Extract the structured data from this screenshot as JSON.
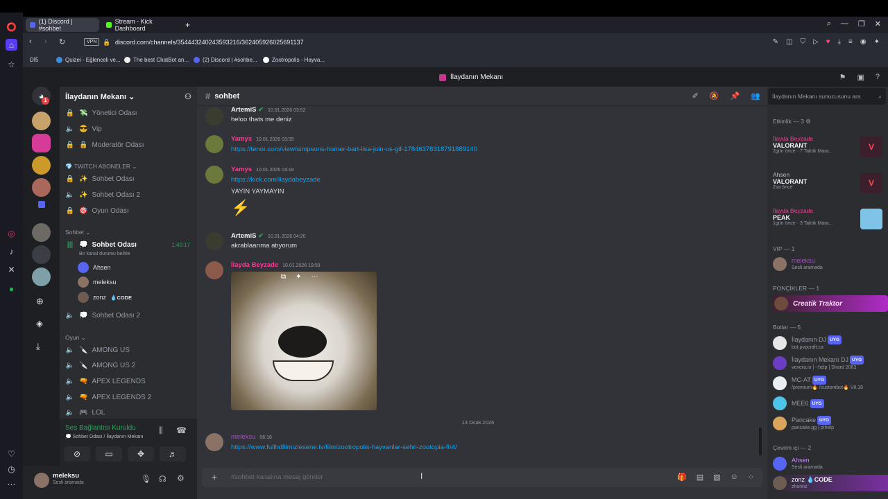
{
  "browser": {
    "tabs": [
      {
        "label": "(1) Discord | #sohbet"
      },
      {
        "label": "Stream - Kick Dashboard"
      }
    ],
    "vpn_label": "VPN",
    "url": "discord.com/channels/354443240243593216/362405926025691137",
    "bookmarks": [
      "Dİ5",
      "Quizei - Eğlenceli ve...",
      "The best ChatBot an...",
      "(2) Discord | #sohbe...",
      "Zootropolis - Hayva..."
    ]
  },
  "window_title": "İlaydanın Mekanı",
  "server": {
    "name": "İlaydanın Mekanı",
    "channels_top": [
      {
        "label": "Yönetici Odası",
        "emoji": "💸"
      },
      {
        "label": "Vip",
        "emoji": "😎"
      },
      {
        "label": "Moderatör Odası",
        "emoji": "🔒"
      }
    ],
    "cat_twitch": "TWITCH ABONELER",
    "channels_twitch": [
      {
        "label": "Sohbet Odası",
        "emoji": "✨"
      },
      {
        "label": "Sohbet Odası 2",
        "emoji": "✨"
      },
      {
        "label": "Oyun Odası",
        "emoji": "🎯"
      }
    ],
    "cat_sohbet": "Sohbet",
    "active_channel": {
      "label": "Sohbet Odası",
      "timer": "1:40:17",
      "status": "Bir kanal durumu belirle"
    },
    "voice_users": [
      {
        "name": "Ahsen"
      },
      {
        "name": "meleksu"
      },
      {
        "name": "zonz",
        "tag": "CODE"
      }
    ],
    "channel_sohbet2": "Sohbet Odası 2",
    "cat_oyun": "Oyun",
    "channels_oyun": [
      "AMONG US",
      "AMONG US 2",
      "APEX LEGENDS",
      "APEX LEGENDS 2",
      "LOL"
    ]
  },
  "voice_panel": {
    "status": "Ses Bağlantısı Kuruldu",
    "location": "Sohbet Odası / İlaydanın Mekanı"
  },
  "user": {
    "name": "meleksu",
    "status": "Sesli aramada"
  },
  "chat": {
    "channel": "sohbet",
    "messages": [
      {
        "author": "ArtemiS",
        "time": "10.01.2026 03:52",
        "text": "heloo thats me deniz"
      },
      {
        "author": "Yamys",
        "time": "10.01.2026 03:55",
        "text": "https://tenor.com/view/simpsons-homer-bart-lisa-join-us-gif-17846376318791889140"
      },
      {
        "author": "Yamys",
        "time": "10.01.2026 04:18",
        "text": "https://kick.com/ilaydabeyzade",
        "text2": "YAYIN YAYMAYIN"
      },
      {
        "author": "ArtemiS",
        "time": "10.01.2026 04:20",
        "text": "akrablaarıma atıyorum"
      },
      {
        "author": "İlayda Beyzade",
        "time": "10.01.2026 19:59"
      },
      {
        "author": "meleksu",
        "time": "06:18",
        "text": "https://www.fullhdfilmizlesene.tv/film/zootropolis-hayvanlar-sehri-zootopia-fh4/"
      }
    ],
    "date_divider": "13 Ocak 2026",
    "input_placeholder": "#sohbet kanalına mesaj gönder"
  },
  "members": {
    "search_placeholder": "İlaydanın Mekanı sunucusunu ara",
    "activity_header": "Etkinlik — 3",
    "activities": [
      {
        "name": "İlayda Beyzade",
        "game": "VALORANT",
        "time": "2gün önce",
        "extra": "7 Taktik Mara..."
      },
      {
        "name": "Ahsen",
        "game": "VALORANT",
        "time": "2sa önce",
        "extra": ""
      },
      {
        "name": "İlayda Beyzade",
        "game": "PEAK",
        "time": "1gün önce",
        "extra": "3 Taktik Mara..."
      }
    ],
    "vip_header": "VIP — 1",
    "vip": [
      {
        "name": "meleksu",
        "status": "Sesli aramada"
      }
    ],
    "poncik_header": "PONÇİKLER — 1",
    "poncik": [
      {
        "name": "Creatik Traktor"
      }
    ],
    "bot_header": "Botlar — 5",
    "bots": [
      {
        "name": "İlaydanın DJ",
        "status": "bot.pvpcraft.ca",
        "badge": "UYG"
      },
      {
        "name": "İlaydanın Mekanı DJ",
        "status": "vexera.io | ~help | Shard 2063",
        "badge": "UYG"
      },
      {
        "name": "MC-AT",
        "status": "/premium🔥 /custombot🔥 V8.18",
        "badge": "UYG"
      },
      {
        "name": "MEE6",
        "status": "",
        "badge": "UYG"
      },
      {
        "name": "Pancake",
        "status": "pancake.gg | p!help",
        "badge": "UYG"
      }
    ],
    "online_header": "Çevrim içi — 2",
    "online": [
      {
        "name": "Ahsen",
        "status": "Sesli aramada"
      },
      {
        "name": "zonz",
        "tag": "CODE",
        "status": "zhonnz"
      }
    ]
  }
}
